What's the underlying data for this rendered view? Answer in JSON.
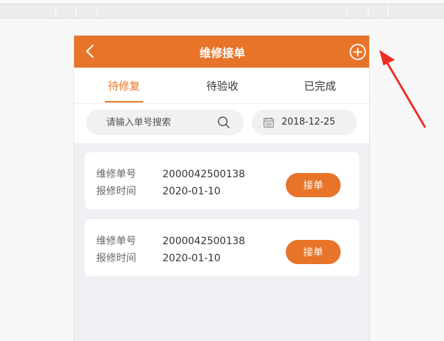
{
  "header": {
    "title": "维修接单",
    "back_icon": "chevron-left-icon",
    "add_icon": "plus-circle-icon"
  },
  "tabs": [
    {
      "label": "待修复",
      "active": true
    },
    {
      "label": "待验收",
      "active": false
    },
    {
      "label": "已完成",
      "active": false
    }
  ],
  "search": {
    "placeholder": "请输入单号搜索",
    "value": "",
    "icon": "search-icon"
  },
  "date_filter": {
    "value": "2018-12-25",
    "icon": "calendar-icon"
  },
  "orders": [
    {
      "order_no_label": "维修单号",
      "order_no": "2000042500138",
      "time_label": "报修时间",
      "time": "2020-01-10",
      "button_label": "接单"
    },
    {
      "order_no_label": "维修单号",
      "order_no": "2000042500138",
      "time_label": "报修时间",
      "time": "2020-01-10",
      "button_label": "接单"
    }
  ],
  "colors": {
    "accent": "#e8742a",
    "annotation_arrow": "#ee2e24",
    "page_background": "#eef0f3"
  }
}
